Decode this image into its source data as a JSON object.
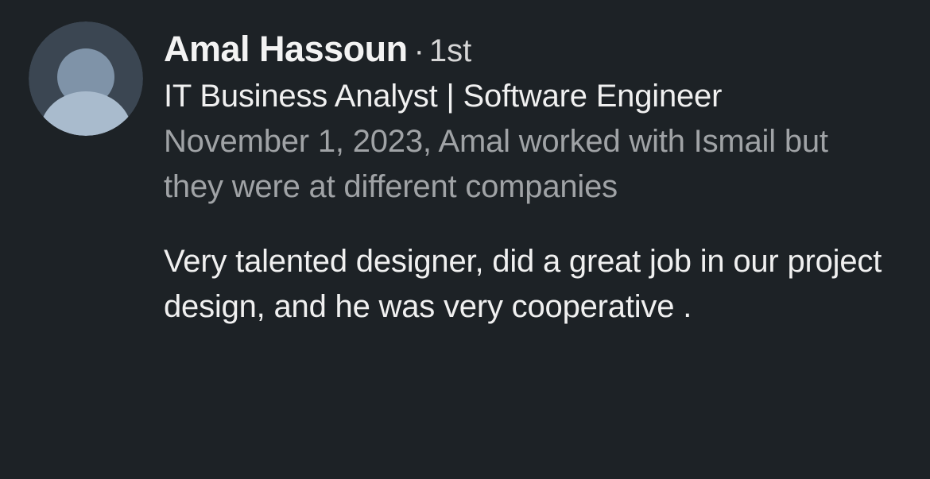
{
  "recommender": {
    "name": "Amal Hassoun",
    "separator": "·",
    "connection_degree": "1st",
    "headline": "IT Business Analyst | Software Engineer"
  },
  "relationship": {
    "text": "November 1, 2023, Amal worked with Ismail but they were at different companies"
  },
  "recommendation": {
    "text": "Very talented designer, did a great job in our project design, and he was very cooperative ."
  },
  "colors": {
    "background": "#1d2226",
    "primary_text": "#f0f0f0",
    "secondary_text": "#a0a3a6",
    "avatar_bg": "#3b4652",
    "avatar_figure": "#8fa1b5"
  },
  "icons": {
    "avatar": "default-profile-avatar-icon"
  }
}
